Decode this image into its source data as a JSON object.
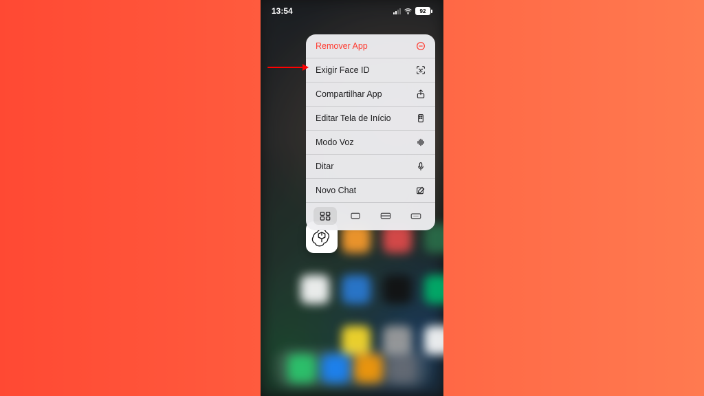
{
  "status_bar": {
    "time": "13:54",
    "battery_percent": "92"
  },
  "context_menu": {
    "items": [
      {
        "label": "Remover App",
        "destructive": true,
        "icon": "minus-circle-icon"
      },
      {
        "label": "Exigir Face ID",
        "destructive": false,
        "icon": "face-id-icon"
      },
      {
        "label": "Compartilhar App",
        "destructive": false,
        "icon": "share-icon"
      },
      {
        "label": "Editar Tela de Início",
        "destructive": false,
        "icon": "apps-grid-icon"
      },
      {
        "label": "Modo Voz",
        "destructive": false,
        "icon": "waveform-icon"
      },
      {
        "label": "Ditar",
        "destructive": false,
        "icon": "mic-icon"
      },
      {
        "label": "Novo Chat",
        "destructive": false,
        "icon": "compose-icon"
      }
    ],
    "widget_sizes": [
      {
        "name": "small-widget",
        "selected": true
      },
      {
        "name": "medium-widget",
        "selected": false
      },
      {
        "name": "large-widget",
        "selected": false
      },
      {
        "name": "lock-widget",
        "selected": false
      }
    ]
  },
  "app": {
    "name": "ChatGPT"
  },
  "annotation": {
    "points_to_item_index": 1
  },
  "colors": {
    "destructive": "#ff3b30",
    "gradient_start": "#ff4933",
    "gradient_end": "#ff7a50"
  }
}
